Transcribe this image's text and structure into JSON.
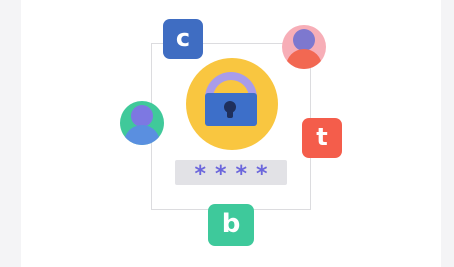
{
  "illustration": {
    "password_mask": "****",
    "tiles": {
      "c_letter": "c",
      "t_letter": "t",
      "b_letter": "b"
    }
  },
  "colors": {
    "page_background": "#f4f4f6",
    "stage_background": "#ffffff",
    "frame_border": "#dcdcdf",
    "lock_circle": "#f9c640",
    "shackle": "#a99cea",
    "lock_body": "#3d6fc9",
    "keyhole": "#1f2f5c",
    "password_field": "#e2e2e6",
    "password_stars": "#6b66dc",
    "tile_c": "#3f6dc2",
    "tile_t": "#f45d4b",
    "tile_b": "#3ec99b",
    "avatar_pink_bg": "#f7aeb7",
    "avatar_green_bg": "#40c99a"
  },
  "icons": [
    "padlock-icon",
    "user-avatar-icon",
    "app-tile-icon"
  ]
}
